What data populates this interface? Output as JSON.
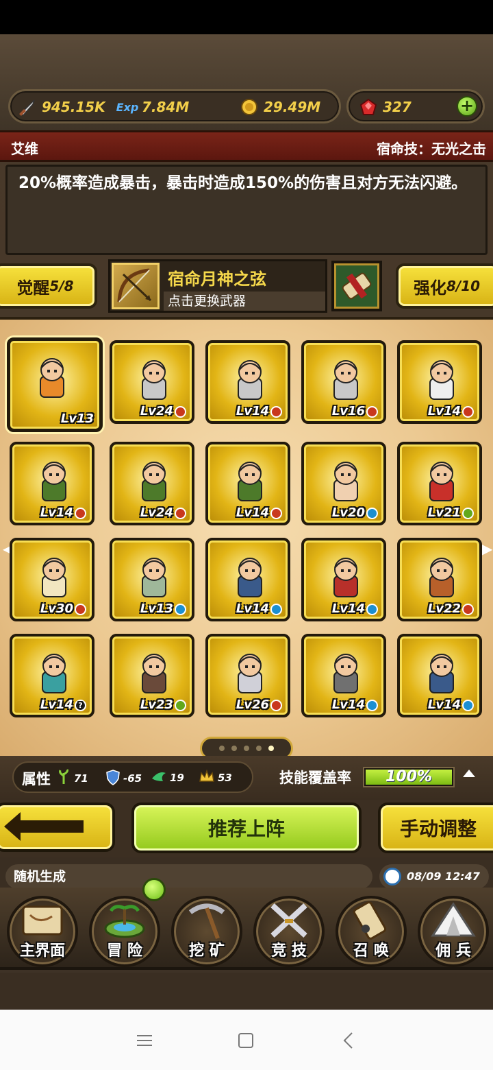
{
  "resources": {
    "attack": {
      "icon": "sword-icon",
      "value": "945.15K"
    },
    "exp": {
      "icon": "exp-icon",
      "value": "7.84M"
    },
    "gold": {
      "icon": "gold-coin-icon",
      "value": "29.49M"
    },
    "gems": {
      "icon": "red-gem-icon",
      "value": "327"
    }
  },
  "hero": {
    "name": "艾维",
    "fate_skill": "宿命技：无光之击",
    "description": "20%概率造成暴击，暴击时造成150%的伤害且对方无法闪避。"
  },
  "weapon": {
    "awaken_label": "觉醒",
    "awaken_value": "5/8",
    "name": "宿命月神之弦",
    "hint": "点击更换武器",
    "enhance_label": "强化",
    "enhance_value": "8/10"
  },
  "heroes": [
    {
      "lv": "Lv13",
      "badge": "",
      "color": "#e88a2a",
      "selected": true
    },
    {
      "lv": "Lv24",
      "badge": "red",
      "color": "#c8c8c8"
    },
    {
      "lv": "Lv14",
      "badge": "red",
      "color": "#c8c8c8"
    },
    {
      "lv": "Lv16",
      "badge": "red",
      "color": "#c8c8c8"
    },
    {
      "lv": "Lv14",
      "badge": "red",
      "color": "#eeeeee"
    },
    {
      "lv": "Lv14",
      "badge": "red",
      "color": "#4d7a2a"
    },
    {
      "lv": "Lv24",
      "badge": "red",
      "color": "#4d7a2a"
    },
    {
      "lv": "Lv14",
      "badge": "red",
      "color": "#4d7a2a"
    },
    {
      "lv": "Lv20",
      "badge": "blue",
      "color": "#f0d0b0"
    },
    {
      "lv": "Lv21",
      "badge": "green",
      "color": "#c8302a"
    },
    {
      "lv": "Lv30",
      "badge": "red",
      "color": "#f2e6c0"
    },
    {
      "lv": "Lv13",
      "badge": "blue",
      "color": "#9fb89a"
    },
    {
      "lv": "Lv14",
      "badge": "blue",
      "color": "#3a5a8a"
    },
    {
      "lv": "Lv14",
      "badge": "blue",
      "color": "#b8302a"
    },
    {
      "lv": "Lv22",
      "badge": "red",
      "color": "#b8602a"
    },
    {
      "lv": "Lv14",
      "badge": "q",
      "color": "#3aa0a0"
    },
    {
      "lv": "Lv23",
      "badge": "green",
      "color": "#6a4a3a"
    },
    {
      "lv": "Lv26",
      "badge": "red",
      "color": "#d0d0d8"
    },
    {
      "lv": "Lv14",
      "badge": "blue",
      "color": "#707070"
    },
    {
      "lv": "Lv14",
      "badge": "blue",
      "color": "#3a5a8a"
    }
  ],
  "pager": {
    "pages": 5,
    "current": 5
  },
  "attributes": {
    "label": "属性",
    "items": [
      {
        "icon": "nature-icon",
        "value": "71"
      },
      {
        "icon": "shield-icon",
        "value": "-65"
      },
      {
        "icon": "wind-icon",
        "value": "19"
      },
      {
        "icon": "crown-icon",
        "value": "53"
      }
    ],
    "skill_label": "技能覆盖率",
    "coverage": "100%",
    "coverage_fraction": 1.0
  },
  "actions": {
    "recommend": "推荐上阵",
    "manual": "手动调整"
  },
  "info": {
    "random": "随机生成",
    "time": "08/09 12:47"
  },
  "nav": [
    {
      "label": "主界面",
      "icon": "map-scroll-icon"
    },
    {
      "label": "冒 险",
      "icon": "island-icon"
    },
    {
      "label": "挖 矿",
      "icon": "pickaxe-icon"
    },
    {
      "label": "竞 技",
      "icon": "crossed-swords-icon"
    },
    {
      "label": "召 唤",
      "icon": "summon-scroll-icon"
    },
    {
      "label": "佣 兵",
      "icon": "tent-icon"
    }
  ],
  "colors": {
    "gold_text": "#f2cf4a",
    "name_bar": "#7a2418",
    "accent_green": "#93c91c",
    "accent_yellow": "#f7e23d"
  }
}
